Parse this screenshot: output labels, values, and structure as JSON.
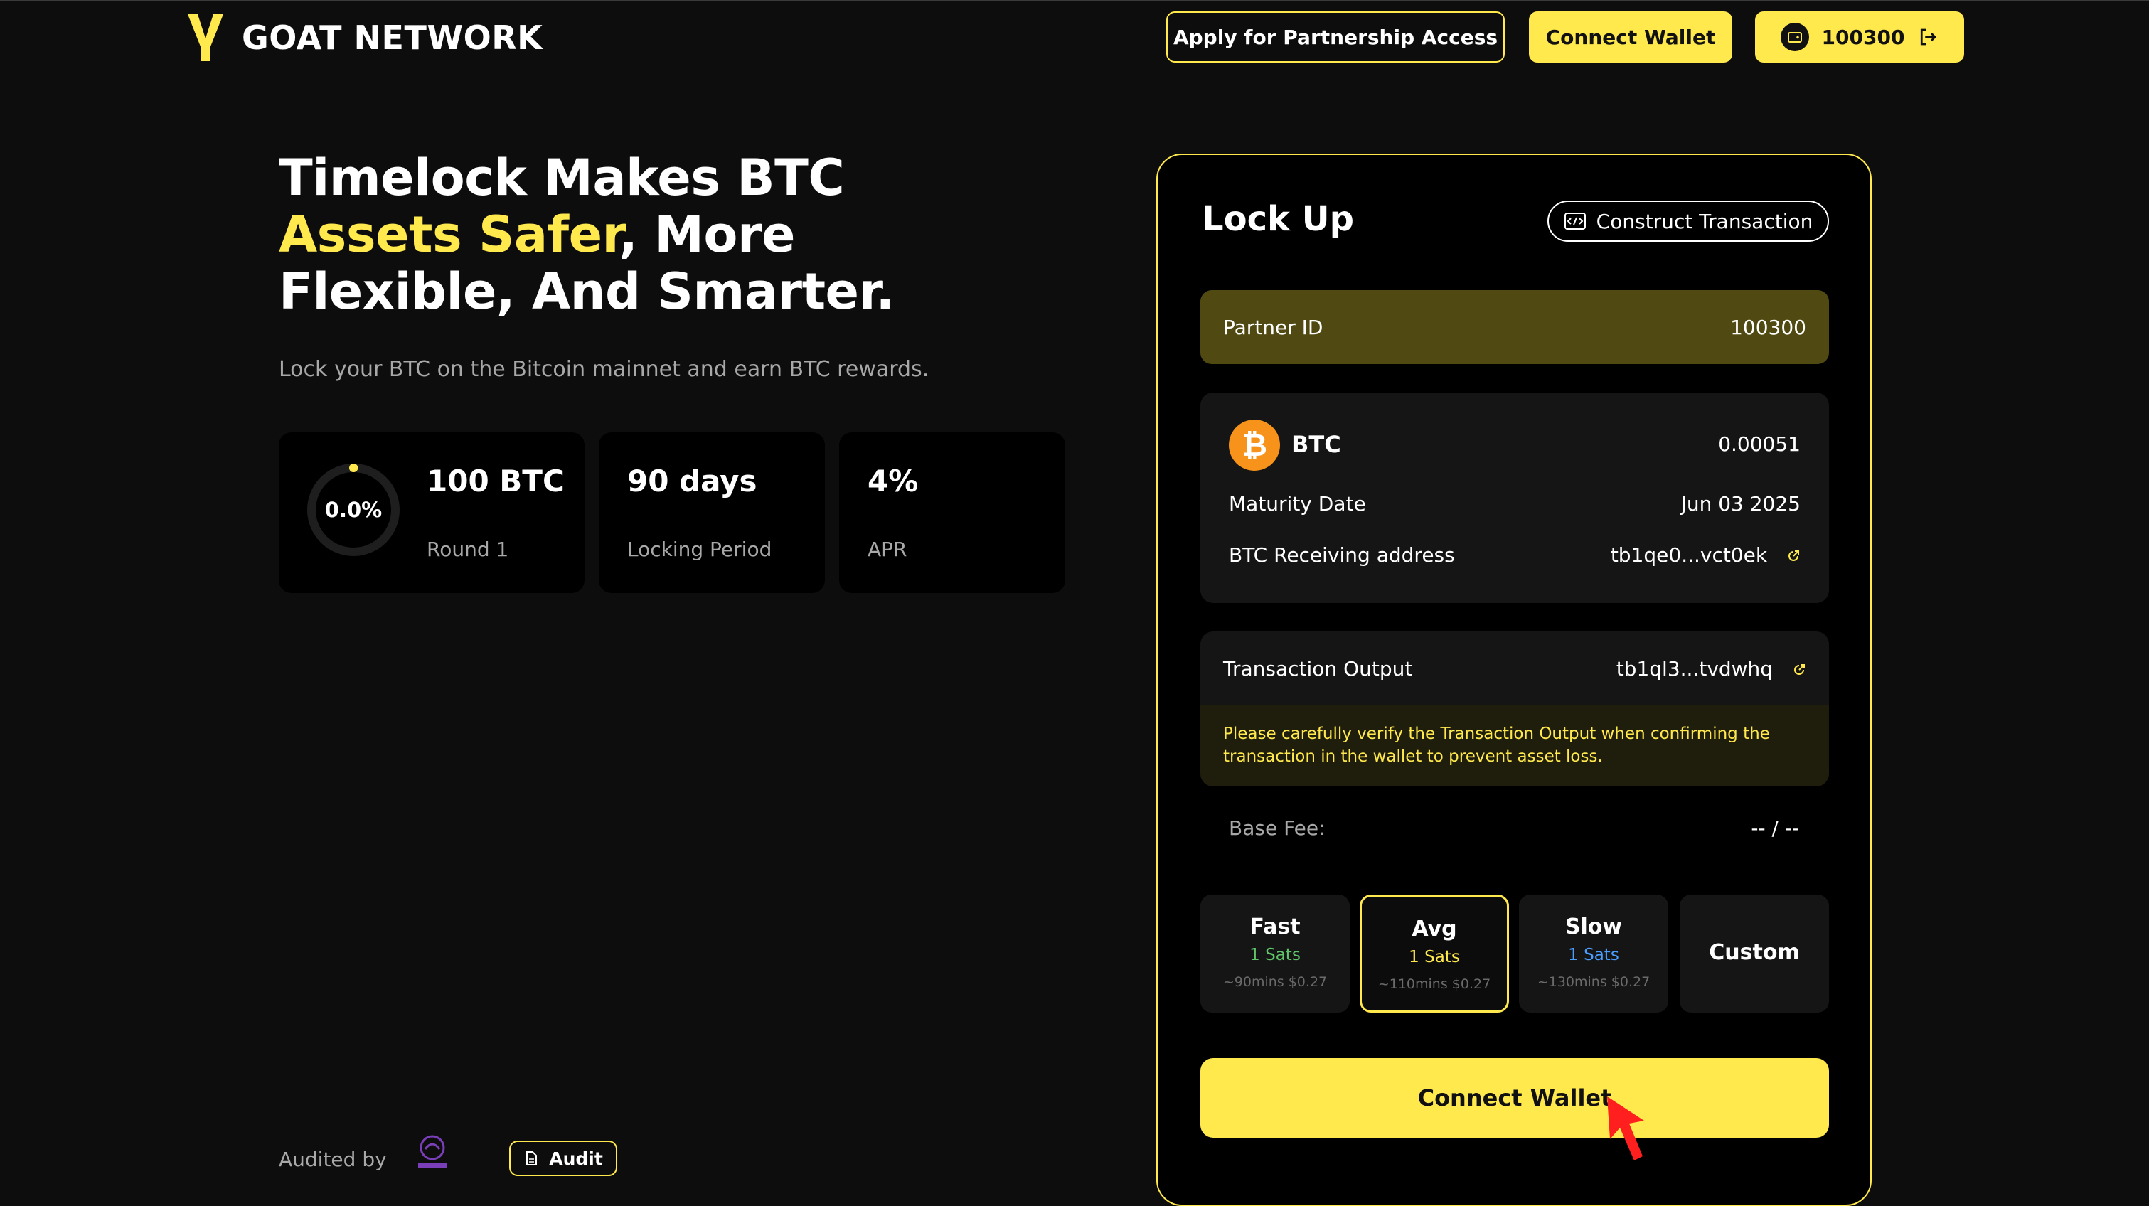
{
  "header": {
    "logo_text": "GOAT NETWORK",
    "partnership_button": "Apply for Partnership Access",
    "connect_wallet_button": "Connect Wallet",
    "account_id": "100300"
  },
  "hero": {
    "title_part1": "Timelock Makes BTC ",
    "title_highlight1": "Assets Safer",
    "title_part2": ", More Flexible, And Smarter.",
    "subtitle": "Lock your BTC on the Bitcoin mainnet and earn BTC rewards."
  },
  "stats": {
    "progress_label": "0.0%",
    "progress_fraction": 0.0,
    "capacity_value": "100 BTC",
    "capacity_label": "Round 1",
    "period_value": "90 days",
    "period_label": "Locking Period",
    "apr_value": "4%",
    "apr_label": "APR"
  },
  "audit": {
    "audited_by": "Audited by",
    "audit_button": "Audit"
  },
  "lock_panel": {
    "title": "Lock Up",
    "construct_button": "Construct Transaction",
    "partner_label": "Partner ID",
    "partner_value": "100300",
    "asset_name": "BTC",
    "asset_amount": "0.00051",
    "maturity_label": "Maturity Date",
    "maturity_value": "Jun 03 2025",
    "receiving_label": "BTC Receiving address",
    "receiving_value": "tb1qe0...vct0ek",
    "output_label": "Transaction Output",
    "output_value": "tb1ql3...tvdwhq",
    "warning": "Please carefully verify the Transaction Output when confirming the transaction in the wallet to prevent asset loss.",
    "base_fee_label": "Base Fee:",
    "base_fee_value": "-- / --",
    "fee_options": [
      {
        "name": "Fast",
        "sats": "1 Sats",
        "estimate": "~90mins $0.27",
        "color": "#5fc46a"
      },
      {
        "name": "Avg",
        "sats": "1 Sats",
        "estimate": "~110mins $0.27",
        "color": "#ffe94d"
      },
      {
        "name": "Slow",
        "sats": "1 Sats",
        "estimate": "~130mins $0.27",
        "color": "#4a9eff"
      },
      {
        "name": "Custom"
      }
    ],
    "selected_fee": "Avg",
    "connect_button": "Connect Wallet"
  },
  "colors": {
    "accent": "#ffe94d",
    "background": "#0d0d0d",
    "partner_bg": "#504a12",
    "bitcoin": "#f7931a"
  }
}
